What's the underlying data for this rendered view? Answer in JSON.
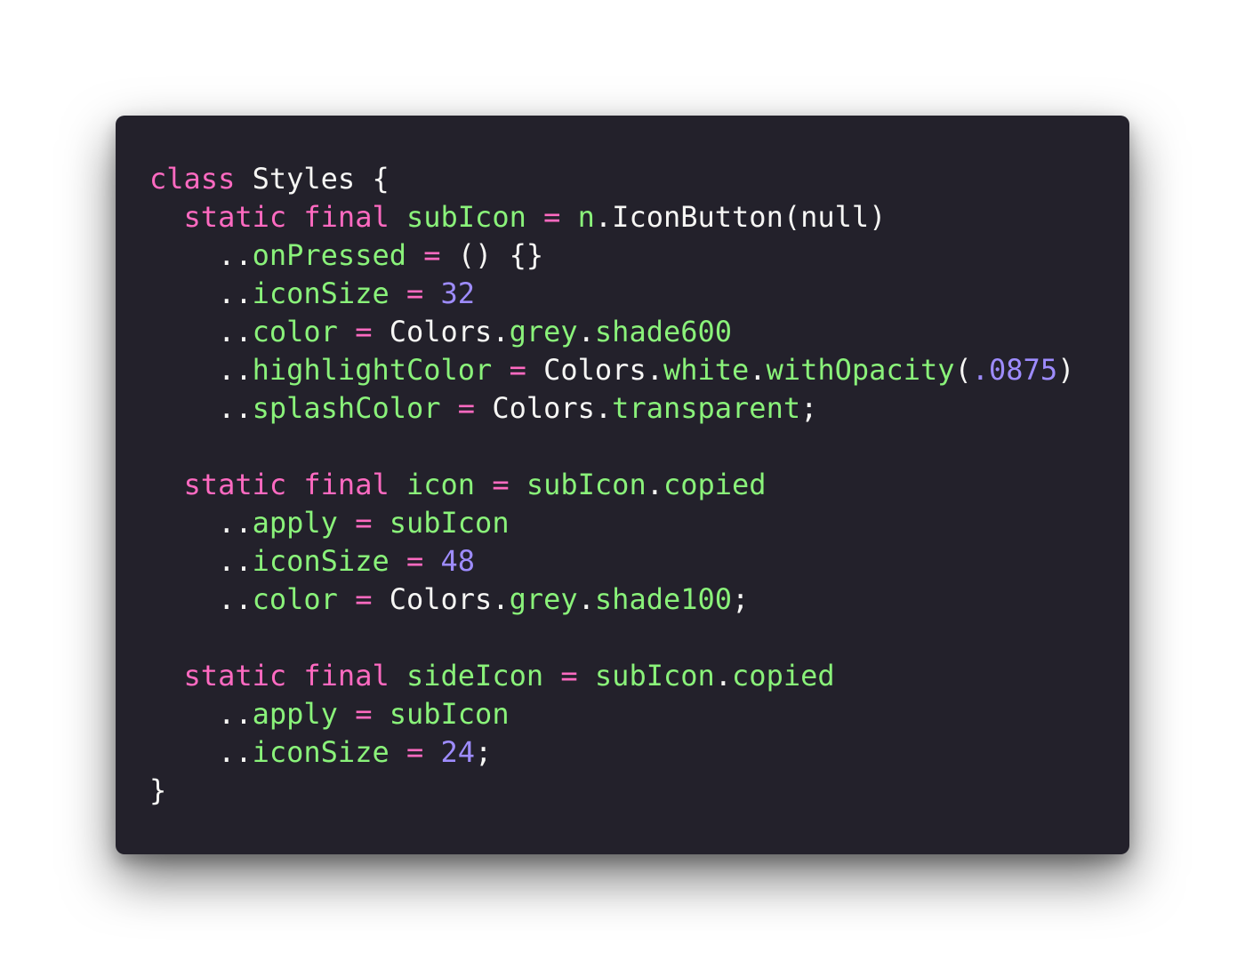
{
  "colors": {
    "background": "#23212b",
    "keyword": "#ff6ac1",
    "operator": "#ff6ac1",
    "identifier": "#8af27a",
    "number": "#9e8cff",
    "plain": "#f6f6f4"
  },
  "code": {
    "lines": [
      [
        {
          "t": "class",
          "c": "kw"
        },
        {
          "t": " Styles {",
          "c": "plain"
        }
      ],
      [
        {
          "t": "  ",
          "c": "plain"
        },
        {
          "t": "static",
          "c": "kw"
        },
        {
          "t": " ",
          "c": "plain"
        },
        {
          "t": "final",
          "c": "kw"
        },
        {
          "t": " ",
          "c": "plain"
        },
        {
          "t": "subIcon",
          "c": "id"
        },
        {
          "t": " ",
          "c": "plain"
        },
        {
          "t": "=",
          "c": "op"
        },
        {
          "t": " ",
          "c": "plain"
        },
        {
          "t": "n",
          "c": "id"
        },
        {
          "t": ".IconButton(null)",
          "c": "plain"
        }
      ],
      [
        {
          "t": "    ..",
          "c": "plain"
        },
        {
          "t": "onPressed",
          "c": "id"
        },
        {
          "t": " ",
          "c": "plain"
        },
        {
          "t": "=",
          "c": "op"
        },
        {
          "t": " () {}",
          "c": "plain"
        }
      ],
      [
        {
          "t": "    ..",
          "c": "plain"
        },
        {
          "t": "iconSize",
          "c": "id"
        },
        {
          "t": " ",
          "c": "plain"
        },
        {
          "t": "=",
          "c": "op"
        },
        {
          "t": " ",
          "c": "plain"
        },
        {
          "t": "32",
          "c": "num"
        }
      ],
      [
        {
          "t": "    ..",
          "c": "plain"
        },
        {
          "t": "color",
          "c": "id"
        },
        {
          "t": " ",
          "c": "plain"
        },
        {
          "t": "=",
          "c": "op"
        },
        {
          "t": " Colors.",
          "c": "plain"
        },
        {
          "t": "grey",
          "c": "id"
        },
        {
          "t": ".",
          "c": "plain"
        },
        {
          "t": "shade600",
          "c": "id"
        }
      ],
      [
        {
          "t": "    ..",
          "c": "plain"
        },
        {
          "t": "highlightColor",
          "c": "id"
        },
        {
          "t": " ",
          "c": "plain"
        },
        {
          "t": "=",
          "c": "op"
        },
        {
          "t": " Colors.",
          "c": "plain"
        },
        {
          "t": "white",
          "c": "id"
        },
        {
          "t": ".",
          "c": "plain"
        },
        {
          "t": "withOpacity",
          "c": "id"
        },
        {
          "t": "(",
          "c": "plain"
        },
        {
          "t": ".0875",
          "c": "num"
        },
        {
          "t": ")",
          "c": "plain"
        }
      ],
      [
        {
          "t": "    ..",
          "c": "plain"
        },
        {
          "t": "splashColor",
          "c": "id"
        },
        {
          "t": " ",
          "c": "plain"
        },
        {
          "t": "=",
          "c": "op"
        },
        {
          "t": " Colors.",
          "c": "plain"
        },
        {
          "t": "transparent",
          "c": "id"
        },
        {
          "t": ";",
          "c": "plain"
        }
      ],
      [],
      [
        {
          "t": "  ",
          "c": "plain"
        },
        {
          "t": "static",
          "c": "kw"
        },
        {
          "t": " ",
          "c": "plain"
        },
        {
          "t": "final",
          "c": "kw"
        },
        {
          "t": " ",
          "c": "plain"
        },
        {
          "t": "icon",
          "c": "id"
        },
        {
          "t": " ",
          "c": "plain"
        },
        {
          "t": "=",
          "c": "op"
        },
        {
          "t": " ",
          "c": "plain"
        },
        {
          "t": "subIcon",
          "c": "id"
        },
        {
          "t": ".",
          "c": "plain"
        },
        {
          "t": "copied",
          "c": "id"
        }
      ],
      [
        {
          "t": "    ..",
          "c": "plain"
        },
        {
          "t": "apply",
          "c": "id"
        },
        {
          "t": " ",
          "c": "plain"
        },
        {
          "t": "=",
          "c": "op"
        },
        {
          "t": " ",
          "c": "plain"
        },
        {
          "t": "subIcon",
          "c": "id"
        }
      ],
      [
        {
          "t": "    ..",
          "c": "plain"
        },
        {
          "t": "iconSize",
          "c": "id"
        },
        {
          "t": " ",
          "c": "plain"
        },
        {
          "t": "=",
          "c": "op"
        },
        {
          "t": " ",
          "c": "plain"
        },
        {
          "t": "48",
          "c": "num"
        }
      ],
      [
        {
          "t": "    ..",
          "c": "plain"
        },
        {
          "t": "color",
          "c": "id"
        },
        {
          "t": " ",
          "c": "plain"
        },
        {
          "t": "=",
          "c": "op"
        },
        {
          "t": " Colors.",
          "c": "plain"
        },
        {
          "t": "grey",
          "c": "id"
        },
        {
          "t": ".",
          "c": "plain"
        },
        {
          "t": "shade100",
          "c": "id"
        },
        {
          "t": ";",
          "c": "plain"
        }
      ],
      [],
      [
        {
          "t": "  ",
          "c": "plain"
        },
        {
          "t": "static",
          "c": "kw"
        },
        {
          "t": " ",
          "c": "plain"
        },
        {
          "t": "final",
          "c": "kw"
        },
        {
          "t": " ",
          "c": "plain"
        },
        {
          "t": "sideIcon",
          "c": "id"
        },
        {
          "t": " ",
          "c": "plain"
        },
        {
          "t": "=",
          "c": "op"
        },
        {
          "t": " ",
          "c": "plain"
        },
        {
          "t": "subIcon",
          "c": "id"
        },
        {
          "t": ".",
          "c": "plain"
        },
        {
          "t": "copied",
          "c": "id"
        }
      ],
      [
        {
          "t": "    ..",
          "c": "plain"
        },
        {
          "t": "apply",
          "c": "id"
        },
        {
          "t": " ",
          "c": "plain"
        },
        {
          "t": "=",
          "c": "op"
        },
        {
          "t": " ",
          "c": "plain"
        },
        {
          "t": "subIcon",
          "c": "id"
        }
      ],
      [
        {
          "t": "    ..",
          "c": "plain"
        },
        {
          "t": "iconSize",
          "c": "id"
        },
        {
          "t": " ",
          "c": "plain"
        },
        {
          "t": "=",
          "c": "op"
        },
        {
          "t": " ",
          "c": "plain"
        },
        {
          "t": "24",
          "c": "num"
        },
        {
          "t": ";",
          "c": "plain"
        }
      ],
      [
        {
          "t": "}",
          "c": "plain"
        }
      ]
    ]
  }
}
